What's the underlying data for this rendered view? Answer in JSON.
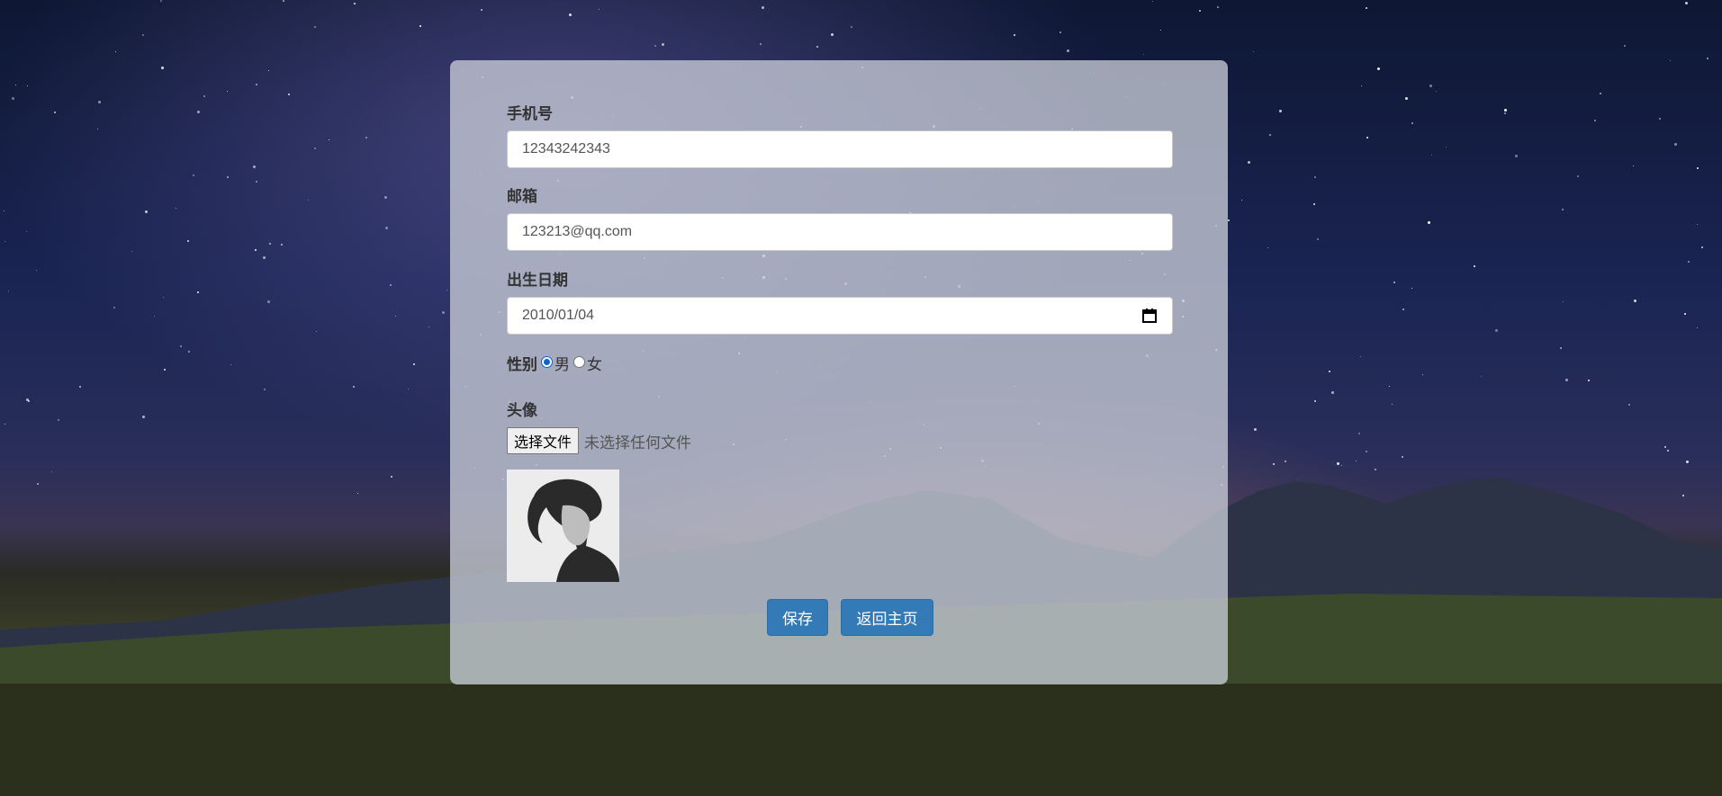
{
  "form": {
    "phone": {
      "label": "手机号",
      "value": "12343242343"
    },
    "email": {
      "label": "邮箱",
      "value": "123213@qq.com"
    },
    "birthdate": {
      "label": "出生日期",
      "value": "2010/01/04",
      "icon": "calendar-icon"
    },
    "gender": {
      "label": "性别",
      "options": [
        {
          "label": "男",
          "checked": true
        },
        {
          "label": "女",
          "checked": false
        }
      ]
    },
    "avatar": {
      "label": "头像",
      "choose_button": "选择文件",
      "no_file_text": "未选择任何文件"
    }
  },
  "actions": {
    "save_label": "保存",
    "back_label": "返回主页"
  },
  "colors": {
    "primary_button": "#337ab7",
    "radio_checked": "#0b63d6"
  }
}
